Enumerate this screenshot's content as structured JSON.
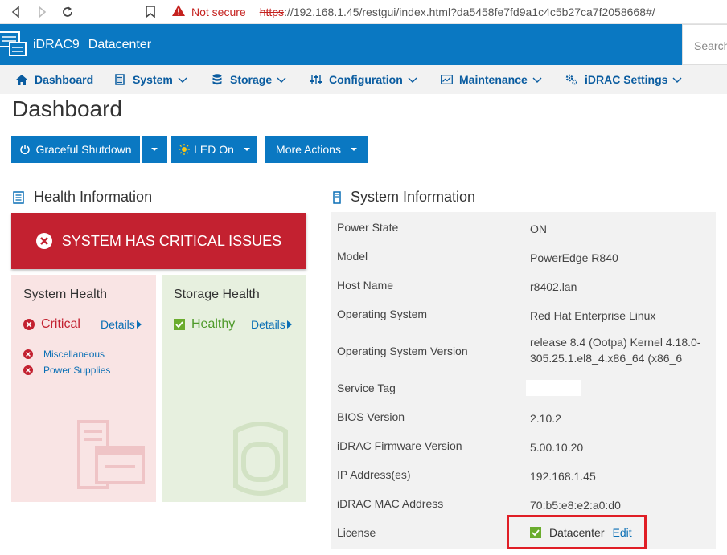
{
  "browser": {
    "security_label": "Not secure",
    "url_scheme": "https",
    "url_rest": "://192.168.1.45/restgui/index.html?da5458fe7fd9a1c4c5b27ca7f2058668#/"
  },
  "header": {
    "product": "iDRAC9",
    "edition": "Datacenter",
    "search_placeholder": "Search"
  },
  "menu": {
    "items": [
      {
        "label": "Dashboard",
        "icon": "home-icon"
      },
      {
        "label": "System",
        "icon": "server-icon"
      },
      {
        "label": "Storage",
        "icon": "database-icon"
      },
      {
        "label": "Configuration",
        "icon": "sliders-icon"
      },
      {
        "label": "Maintenance",
        "icon": "chart-icon"
      },
      {
        "label": "iDRAC Settings",
        "icon": "gears-icon"
      }
    ]
  },
  "page": {
    "title": "Dashboard"
  },
  "actions": {
    "graceful_shutdown": "Graceful Shutdown",
    "led_on": "LED On",
    "more_actions": "More Actions"
  },
  "health": {
    "title": "Health Information",
    "banner": "SYSTEM HAS CRITICAL ISSUES",
    "system_card": {
      "title": "System Health",
      "status": "Critical",
      "details": "Details",
      "issues": [
        "Miscellaneous",
        "Power Supplies"
      ]
    },
    "storage_card": {
      "title": "Storage Health",
      "status": "Healthy",
      "details": "Details"
    }
  },
  "system_info": {
    "title": "System Information",
    "rows": [
      {
        "label": "Power State",
        "value": "ON"
      },
      {
        "label": "Model",
        "value": "PowerEdge R840"
      },
      {
        "label": "Host Name",
        "value": "r8402.lan"
      },
      {
        "label": "Operating System",
        "value": "Red Hat Enterprise Linux"
      },
      {
        "label": "Operating System Version",
        "value_line1": "release 8.4 (Ootpa) Kernel 4.18.0-",
        "value_line2": "305.25.1.el8_4.x86_64 (x86_6"
      },
      {
        "label": "Service Tag",
        "value": ""
      },
      {
        "label": "BIOS Version",
        "value": "2.10.2"
      },
      {
        "label": "iDRAC Firmware Version",
        "value": "5.00.10.20"
      },
      {
        "label": "IP Address(es)",
        "value": "192.168.1.45"
      },
      {
        "label": "iDRAC MAC Address",
        "value": "70:b5:e8:e2:a0:d0"
      },
      {
        "label": "License",
        "value": "Datacenter",
        "action": "Edit"
      }
    ]
  },
  "colors": {
    "brand_blue": "#0a78c2",
    "critical_red": "#c32130",
    "healthy_green": "#6aac2d",
    "link_blue": "#0a6fb5",
    "highlight_red": "#e01e26"
  }
}
